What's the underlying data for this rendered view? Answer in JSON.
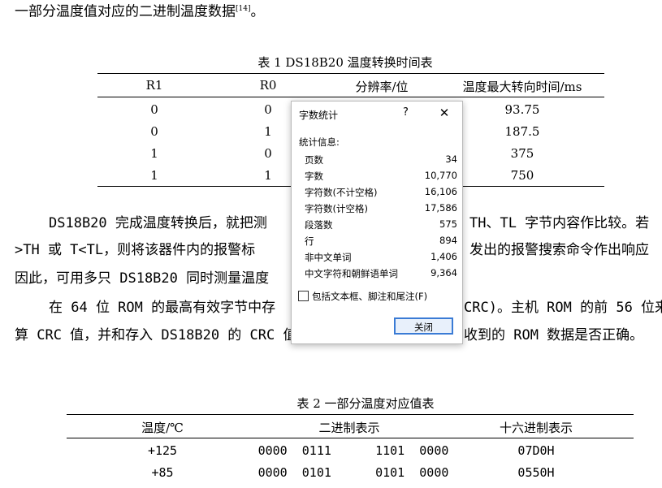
{
  "doc": {
    "line_top": "一部分温度值对应的二进制温度数据",
    "line_top_ref": "[14]",
    "line_top_end": "。",
    "table1": {
      "caption": "表 1  DS18B20 温度转换时间表",
      "headers": [
        "R1",
        "R0",
        "分辨率/位",
        "温度最大转向时间/ms"
      ],
      "rows": [
        [
          "0",
          "0",
          "",
          "93.75"
        ],
        [
          "0",
          "1",
          "",
          "187.5"
        ],
        [
          "1",
          "0",
          "",
          "375"
        ],
        [
          "1",
          "1",
          "",
          "750"
        ]
      ]
    },
    "para1": {
      "l1_left": "DS18B20 完成温度转换后，就把测",
      "l1_right": "TH、TL 字节内容作比较。若",
      "l2_left": ">TH 或 T<TL，则将该器件内的报警标",
      "l2_right": "发出的报警搜索命令作出响应",
      "l3_left": "因此，可用多只 DS18B20 同时测量温度"
    },
    "para2": {
      "l1_left": "在 64 位 ROM 的最高有效字节中存",
      "l1_right": "CRC)。主机 ROM 的前 56 位来",
      "l2_left": "算 CRC 值，并和存入 DS18B20 的 CRC 值",
      "l2_right": "收到的 ROM 数据是否正确。"
    },
    "table2": {
      "caption": "表 2    一部分温度对应值表",
      "headers": [
        "温度/℃",
        "二进制表示",
        "十六进制表示"
      ],
      "rows": [
        [
          "+125",
          "0000  0111      1101  0000",
          "07D0H"
        ],
        [
          "+85",
          "0000  0101      0101  0000",
          "0550H"
        ]
      ]
    }
  },
  "dialog": {
    "title": "字数统计",
    "help": "?",
    "close": "✕",
    "section": "统计信息:",
    "stats": [
      {
        "label": "页数",
        "value": "34"
      },
      {
        "label": "字数",
        "value": "10,770"
      },
      {
        "label": "字符数(不计空格)",
        "value": "16,106"
      },
      {
        "label": "字符数(计空格)",
        "value": "17,586"
      },
      {
        "label": "段落数",
        "value": "575"
      },
      {
        "label": "行",
        "value": "894"
      },
      {
        "label": "非中文单词",
        "value": "1,406"
      },
      {
        "label": "中文字符和朝鲜语单词",
        "value": "9,364"
      }
    ],
    "checkbox_label": "包括文本框、脚注和尾注(F)",
    "checkbox_checked": false,
    "close_button": "关闭"
  }
}
